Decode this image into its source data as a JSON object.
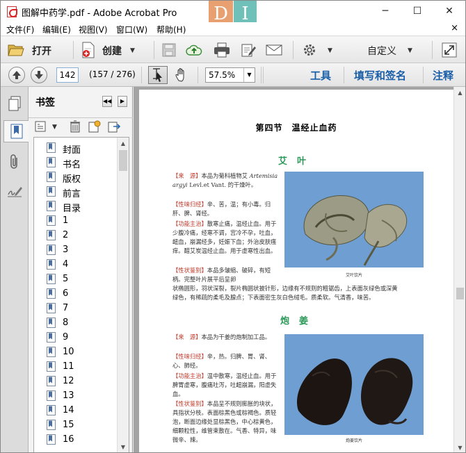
{
  "window": {
    "title": "图解中药学.pdf - Adobe Acrobat Pro",
    "logo_letters": [
      "D",
      "I"
    ],
    "minimize": "─",
    "maximize": "☐",
    "close": "✕"
  },
  "menu": [
    "文件(F)",
    "编辑(E)",
    "视图(V)",
    "窗口(W)",
    "帮助(H)"
  ],
  "menu_close": "×",
  "toolbar": {
    "open_label": "打开",
    "create_label": "创建",
    "customize_label": "自定义"
  },
  "nav": {
    "page_number": "142",
    "page_count": "(157 / 276)",
    "zoom": "57.5%",
    "tools_label": "工具",
    "fill_sign_label": "填写和签名",
    "comment_label": "注释"
  },
  "panel": {
    "title": "书签",
    "bookmarks": [
      "封面",
      "书名",
      "版权",
      "前言",
      "目录",
      "1",
      "2",
      "3",
      "4",
      "5",
      "6",
      "7",
      "8",
      "9",
      "10",
      "11",
      "12",
      "13",
      "14",
      "15",
      "16"
    ]
  },
  "document": {
    "section_title": "第四节　温经止血药",
    "herb1": {
      "name": "艾叶",
      "source_tag": "【来　源】",
      "source_text": "本品为菊科植物艾",
      "latin": "Artemisia argyi",
      "latin_rest": "Levl.et Vant. 的干燥叶。",
      "nature_tag": "【性味归经】",
      "nature_text": "辛、苦，温；有小毒。归肝、脾、肾经。",
      "func_tag": "【功能主治】",
      "func_text": "散寒止痛，温经止血。用于少腹冷痛，经寒不调，宫冷不孕，吐血，衄血，崩漏经多，妊娠下血；外治皮肤瘙痒。醋艾炭温经止血。用于虚寒性出血。",
      "feat_tag": "【性状鉴别】",
      "feat_text_a": "本品多皱缩、破碎，有短柄。完整叶片展平后呈卵",
      "feat_text_b": "状椭圆形，羽状深裂，裂片椭圆状披针形，边缘有不规则的粗锯齿，上表面灰绿色或深黄",
      "feat_text_c": "绿色，有稀疏的柔毛及腺点；下表面密生灰白色绒毛。质柔软。气清香，味苦。",
      "caption": "艾叶饮片"
    },
    "herb2": {
      "name": "炮姜",
      "source_tag": "【来　源】",
      "source_text": "本品为干姜的炮制加工品。",
      "nature_tag": "【性味归经】",
      "nature_text": "辛，热。归脾、胃、肾、心、肺经。",
      "func_tag": "【功能主治】",
      "func_text": "温中散寒，温经止血。用于脾胃虚寒，腹痛吐泻，吐衄崩漏，阳虚失血。",
      "feat_tag": "【性状鉴别】",
      "feat_text": "本品呈不规则膨胀的块状，具指状分枝。表面棕黑色或棕褐色。质轻泡，断面边缘处显棕黑色，中心棕黄色，细颗粒性，维管束散在。气香、特异，味微辛、辣。",
      "caption": "炮姜饮片"
    }
  },
  "colors": {
    "accent": "#1a5ea8",
    "herb_title": "#2d9a5a",
    "tag": "#c0392b",
    "photo_bg": "#6f9fd2"
  }
}
